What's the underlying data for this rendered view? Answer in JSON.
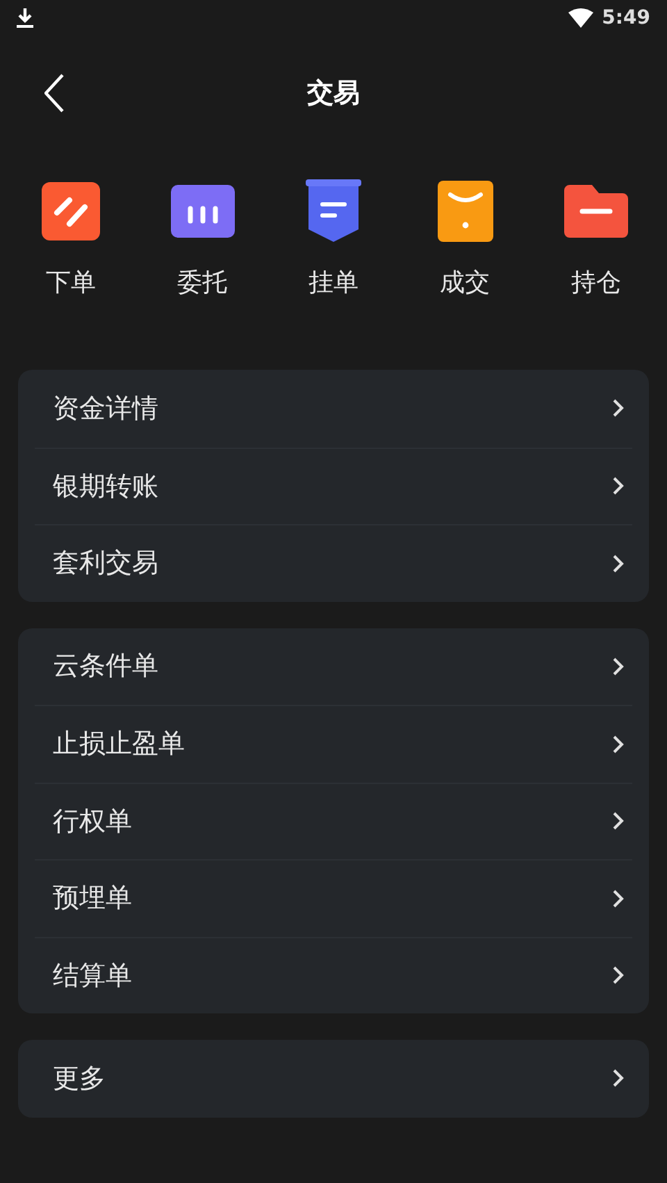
{
  "status_bar": {
    "time": "5:49"
  },
  "header": {
    "title": "交易"
  },
  "shortcuts": [
    {
      "label": "下单",
      "kind": "order"
    },
    {
      "label": "委托",
      "kind": "entrust"
    },
    {
      "label": "挂单",
      "kind": "pending"
    },
    {
      "label": "成交",
      "kind": "deal"
    },
    {
      "label": "持仓",
      "kind": "position"
    }
  ],
  "groups": [
    {
      "items": [
        "资金详情",
        "银期转账",
        "套利交易"
      ]
    },
    {
      "items": [
        "云条件单",
        "止损止盈单",
        "行权单",
        "预埋单",
        "结算单"
      ]
    },
    {
      "items": [
        "更多"
      ]
    }
  ]
}
